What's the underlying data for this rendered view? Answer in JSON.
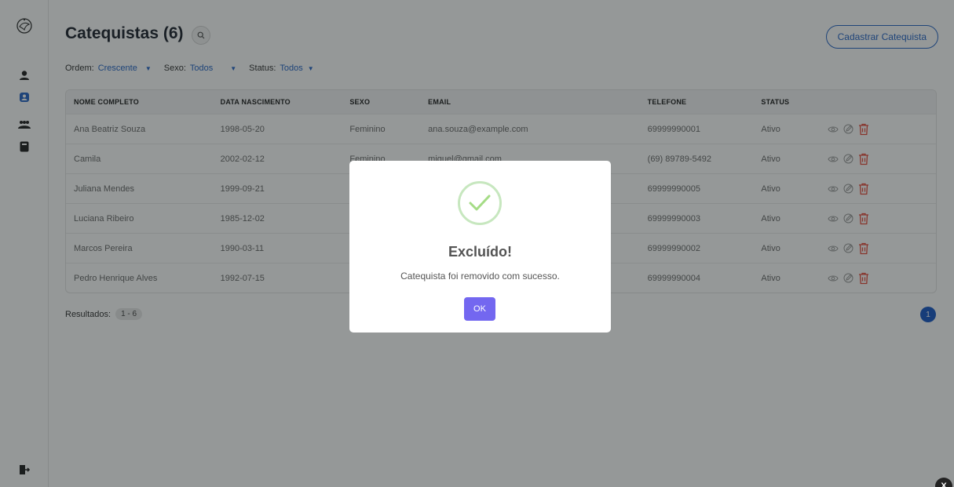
{
  "sidebar": {
    "items": [
      {
        "name": "logo",
        "icon": "dove-logo-icon"
      },
      {
        "name": "person",
        "icon": "person-icon"
      },
      {
        "name": "catequistas",
        "icon": "user-badge-icon",
        "active": true
      },
      {
        "name": "group",
        "icon": "group-icon"
      },
      {
        "name": "book",
        "icon": "book-icon"
      },
      {
        "name": "logout",
        "icon": "logout-icon"
      }
    ]
  },
  "header": {
    "title": "Catequistas (6)",
    "register_label": "Cadastrar Catequista"
  },
  "filters": {
    "order_label": "Ordem:",
    "order_value": "Crescente",
    "sex_label": "Sexo:",
    "sex_value": "Todos",
    "status_label": "Status:",
    "status_value": "Todos"
  },
  "table": {
    "headers": [
      "NOME COMPLETO",
      "DATA NASCIMENTO",
      "SEXO",
      "EMAIL",
      "TELEFONE",
      "STATUS"
    ],
    "rows": [
      [
        "Ana Beatriz Souza",
        "1998-05-20",
        "Feminino",
        "ana.souza@example.com",
        "69999990001",
        "Ativo"
      ],
      [
        "Camila",
        "2002-02-12",
        "Feminino",
        "miguel@gmail.com",
        "(69) 89789-5492",
        "Ativo"
      ],
      [
        "Juliana Mendes",
        "1999-09-21",
        "",
        "",
        "69999990005",
        "Ativo"
      ],
      [
        "Luciana Ribeiro",
        "1985-12-02",
        "",
        "",
        "69999990003",
        "Ativo"
      ],
      [
        "Marcos Pereira",
        "1990-03-11",
        "",
        "",
        "69999990002",
        "Ativo"
      ],
      [
        "Pedro Henrique Alves",
        "1992-07-15",
        "",
        "",
        "69999990004",
        "Ativo"
      ]
    ]
  },
  "footer": {
    "results_label": "Resultados:",
    "results_range": "1 - 6",
    "page": "1"
  },
  "modal": {
    "title": "Excluído!",
    "message": "Catequista foi removido com sucesso.",
    "ok_label": "OK"
  },
  "corner": {
    "label": "X"
  },
  "colors": {
    "accent": "#2867c7",
    "ok_button": "#7367f0",
    "success": "#a5dc86",
    "danger": "#e74c3c"
  }
}
